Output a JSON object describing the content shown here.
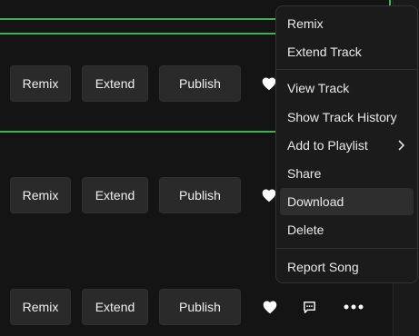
{
  "rows": [
    {
      "remix": "Remix",
      "extend": "Extend",
      "publish": "Publish"
    },
    {
      "remix": "Remix",
      "extend": "Extend",
      "publish": "Publish"
    },
    {
      "remix": "Remix",
      "extend": "Extend",
      "publish": "Publish"
    }
  ],
  "menu": {
    "items": [
      "Remix",
      "Extend Track",
      "View Track",
      "Show Track History",
      "Add to Playlist",
      "Share",
      "Download",
      "Delete",
      "Report Song"
    ],
    "highlighted": "Download"
  },
  "colors": {
    "accent_green": "#3fb54f",
    "background": "#141414",
    "button_bg": "#2a2a2a",
    "menu_bg": "#1b1b1b"
  },
  "icons": [
    "heart-icon",
    "comment-icon",
    "more-icon",
    "chevron-right-icon"
  ]
}
